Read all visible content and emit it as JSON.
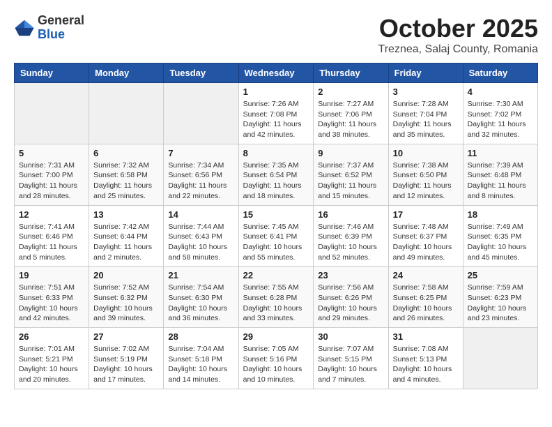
{
  "header": {
    "logo_general": "General",
    "logo_blue": "Blue",
    "title": "October 2025",
    "subtitle": "Treznea, Salaj County, Romania"
  },
  "days_of_week": [
    "Sunday",
    "Monday",
    "Tuesday",
    "Wednesday",
    "Thursday",
    "Friday",
    "Saturday"
  ],
  "weeks": [
    [
      {
        "num": "",
        "info": ""
      },
      {
        "num": "",
        "info": ""
      },
      {
        "num": "",
        "info": ""
      },
      {
        "num": "1",
        "info": "Sunrise: 7:26 AM\nSunset: 7:08 PM\nDaylight: 11 hours and 42 minutes."
      },
      {
        "num": "2",
        "info": "Sunrise: 7:27 AM\nSunset: 7:06 PM\nDaylight: 11 hours and 38 minutes."
      },
      {
        "num": "3",
        "info": "Sunrise: 7:28 AM\nSunset: 7:04 PM\nDaylight: 11 hours and 35 minutes."
      },
      {
        "num": "4",
        "info": "Sunrise: 7:30 AM\nSunset: 7:02 PM\nDaylight: 11 hours and 32 minutes."
      }
    ],
    [
      {
        "num": "5",
        "info": "Sunrise: 7:31 AM\nSunset: 7:00 PM\nDaylight: 11 hours and 28 minutes."
      },
      {
        "num": "6",
        "info": "Sunrise: 7:32 AM\nSunset: 6:58 PM\nDaylight: 11 hours and 25 minutes."
      },
      {
        "num": "7",
        "info": "Sunrise: 7:34 AM\nSunset: 6:56 PM\nDaylight: 11 hours and 22 minutes."
      },
      {
        "num": "8",
        "info": "Sunrise: 7:35 AM\nSunset: 6:54 PM\nDaylight: 11 hours and 18 minutes."
      },
      {
        "num": "9",
        "info": "Sunrise: 7:37 AM\nSunset: 6:52 PM\nDaylight: 11 hours and 15 minutes."
      },
      {
        "num": "10",
        "info": "Sunrise: 7:38 AM\nSunset: 6:50 PM\nDaylight: 11 hours and 12 minutes."
      },
      {
        "num": "11",
        "info": "Sunrise: 7:39 AM\nSunset: 6:48 PM\nDaylight: 11 hours and 8 minutes."
      }
    ],
    [
      {
        "num": "12",
        "info": "Sunrise: 7:41 AM\nSunset: 6:46 PM\nDaylight: 11 hours and 5 minutes."
      },
      {
        "num": "13",
        "info": "Sunrise: 7:42 AM\nSunset: 6:44 PM\nDaylight: 11 hours and 2 minutes."
      },
      {
        "num": "14",
        "info": "Sunrise: 7:44 AM\nSunset: 6:43 PM\nDaylight: 10 hours and 58 minutes."
      },
      {
        "num": "15",
        "info": "Sunrise: 7:45 AM\nSunset: 6:41 PM\nDaylight: 10 hours and 55 minutes."
      },
      {
        "num": "16",
        "info": "Sunrise: 7:46 AM\nSunset: 6:39 PM\nDaylight: 10 hours and 52 minutes."
      },
      {
        "num": "17",
        "info": "Sunrise: 7:48 AM\nSunset: 6:37 PM\nDaylight: 10 hours and 49 minutes."
      },
      {
        "num": "18",
        "info": "Sunrise: 7:49 AM\nSunset: 6:35 PM\nDaylight: 10 hours and 45 minutes."
      }
    ],
    [
      {
        "num": "19",
        "info": "Sunrise: 7:51 AM\nSunset: 6:33 PM\nDaylight: 10 hours and 42 minutes."
      },
      {
        "num": "20",
        "info": "Sunrise: 7:52 AM\nSunset: 6:32 PM\nDaylight: 10 hours and 39 minutes."
      },
      {
        "num": "21",
        "info": "Sunrise: 7:54 AM\nSunset: 6:30 PM\nDaylight: 10 hours and 36 minutes."
      },
      {
        "num": "22",
        "info": "Sunrise: 7:55 AM\nSunset: 6:28 PM\nDaylight: 10 hours and 33 minutes."
      },
      {
        "num": "23",
        "info": "Sunrise: 7:56 AM\nSunset: 6:26 PM\nDaylight: 10 hours and 29 minutes."
      },
      {
        "num": "24",
        "info": "Sunrise: 7:58 AM\nSunset: 6:25 PM\nDaylight: 10 hours and 26 minutes."
      },
      {
        "num": "25",
        "info": "Sunrise: 7:59 AM\nSunset: 6:23 PM\nDaylight: 10 hours and 23 minutes."
      }
    ],
    [
      {
        "num": "26",
        "info": "Sunrise: 7:01 AM\nSunset: 5:21 PM\nDaylight: 10 hours and 20 minutes."
      },
      {
        "num": "27",
        "info": "Sunrise: 7:02 AM\nSunset: 5:19 PM\nDaylight: 10 hours and 17 minutes."
      },
      {
        "num": "28",
        "info": "Sunrise: 7:04 AM\nSunset: 5:18 PM\nDaylight: 10 hours and 14 minutes."
      },
      {
        "num": "29",
        "info": "Sunrise: 7:05 AM\nSunset: 5:16 PM\nDaylight: 10 hours and 10 minutes."
      },
      {
        "num": "30",
        "info": "Sunrise: 7:07 AM\nSunset: 5:15 PM\nDaylight: 10 hours and 7 minutes."
      },
      {
        "num": "31",
        "info": "Sunrise: 7:08 AM\nSunset: 5:13 PM\nDaylight: 10 hours and 4 minutes."
      },
      {
        "num": "",
        "info": ""
      }
    ]
  ]
}
